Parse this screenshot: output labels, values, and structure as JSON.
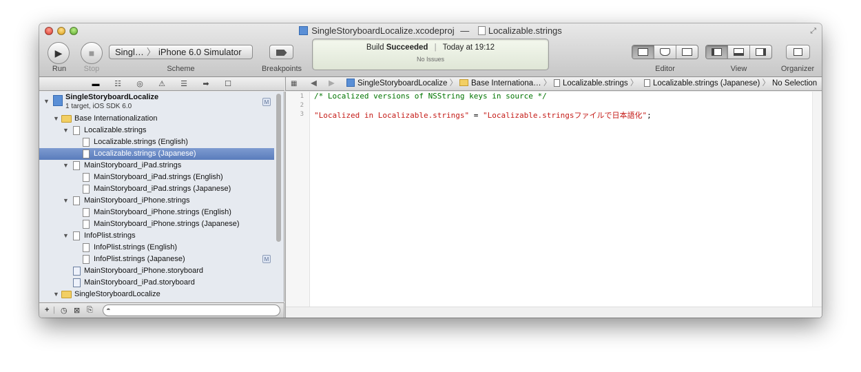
{
  "window": {
    "title_project": "SingleStoryboardLocalize.xcodeproj",
    "title_separator": "—",
    "title_file": "Localizable.strings"
  },
  "toolbar": {
    "run_label": "Run",
    "stop_label": "Stop",
    "scheme_label": "Scheme",
    "scheme_target": "Singl…",
    "scheme_destination": "iPhone 6.0 Simulator",
    "breakpoints_label": "Breakpoints",
    "editor_label": "Editor",
    "view_label": "View",
    "organizer_label": "Organizer"
  },
  "activity": {
    "build_prefix": "Build",
    "build_result": "Succeeded",
    "time": "Today at 19:12",
    "issues": "No Issues"
  },
  "jumpbar": {
    "items": [
      "SingleStoryboardLocalize",
      "Base Internationa…",
      "Localizable.strings",
      "Localizable.strings (Japanese)",
      "No Selection"
    ]
  },
  "navigator": {
    "project_name": "SingleStoryboardLocalize",
    "project_subtitle": "1 target, iOS SDK 6.0",
    "project_badge": "M",
    "rows": [
      {
        "label": "Base Internationalization",
        "badge": ""
      },
      {
        "label": "Localizable.strings",
        "badge": ""
      },
      {
        "label": "Localizable.strings (English)",
        "badge": ""
      },
      {
        "label": "Localizable.strings (Japanese)",
        "badge": ""
      },
      {
        "label": "MainStoryboard_iPad.strings",
        "badge": ""
      },
      {
        "label": "MainStoryboard_iPad.strings (English)",
        "badge": ""
      },
      {
        "label": "MainStoryboard_iPad.strings (Japanese)",
        "badge": ""
      },
      {
        "label": "MainStoryboard_iPhone.strings",
        "badge": ""
      },
      {
        "label": "MainStoryboard_iPhone.strings (English)",
        "badge": ""
      },
      {
        "label": "MainStoryboard_iPhone.strings (Japanese)",
        "badge": ""
      },
      {
        "label": "InfoPlist.strings",
        "badge": ""
      },
      {
        "label": "InfoPlist.strings (English)",
        "badge": ""
      },
      {
        "label": "InfoPlist.strings (Japanese)",
        "badge": "M"
      },
      {
        "label": "MainStoryboard_iPhone.storyboard",
        "badge": ""
      },
      {
        "label": "MainStoryboard_iPad.storyboard",
        "badge": ""
      },
      {
        "label": "SingleStoryboardLocalize",
        "badge": ""
      }
    ],
    "footer_add": "+"
  },
  "editor": {
    "line_numbers": [
      "1",
      "2",
      "3"
    ],
    "line1_comment": "/* Localized versions of NSString keys in source */",
    "line3_key": "\"Localized in Localizable.strings\"",
    "line3_eq": " = ",
    "line3_value": "\"Localizable.stringsファイルで日本語化\"",
    "line3_end": ";"
  },
  "colors": {
    "comment": "#007400",
    "string": "#c41a16",
    "selection": "#5a7cbc"
  }
}
